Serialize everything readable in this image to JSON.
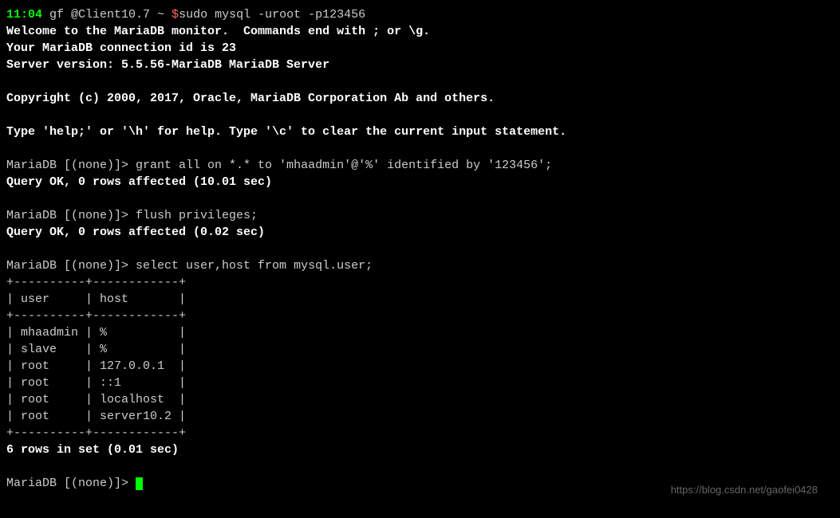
{
  "prompt": {
    "time": "11:04",
    "user_host": " gf @Client10.7 ~ ",
    "dollar": "$",
    "command": "sudo mysql -uroot -p123456"
  },
  "welcome": {
    "line1": "Welcome to the MariaDB monitor.  Commands end with ; or \\g.",
    "line2": "Your MariaDB connection id is 23",
    "line3": "Server version: 5.5.56-MariaDB MariaDB Server"
  },
  "copyright": "Copyright (c) 2000, 2017, Oracle, MariaDB Corporation Ab and others.",
  "help_line": "Type 'help;' or '\\h' for help. Type '\\c' to clear the current input statement.",
  "queries": {
    "q1_prompt": "MariaDB [(none)]> ",
    "q1": "grant all on *.* to 'mhaadmin'@'%' identified by '123456';",
    "q1_result": "Query OK, 0 rows affected (10.01 sec)",
    "q2_prompt": "MariaDB [(none)]> ",
    "q2": "flush privileges;",
    "q2_result": "Query OK, 0 rows affected (0.02 sec)",
    "q3_prompt": "MariaDB [(none)]> ",
    "q3": "select user,host from mysql.user;"
  },
  "table": {
    "sep_top": "+----------+------------+",
    "header": "| user     | host       |",
    "sep_mid": "+----------+------------+",
    "rows": [
      "| mhaadmin | %          |",
      "| slave    | %          |",
      "| root     | 127.0.0.1  |",
      "| root     | ::1        |",
      "| root     | localhost  |",
      "| root     | server10.2 |"
    ],
    "sep_bot": "+----------+------------+",
    "footer": "6 rows in set (0.01 sec)"
  },
  "final_prompt": "MariaDB [(none)]> ",
  "watermark": "https://blog.csdn.net/gaofei0428"
}
